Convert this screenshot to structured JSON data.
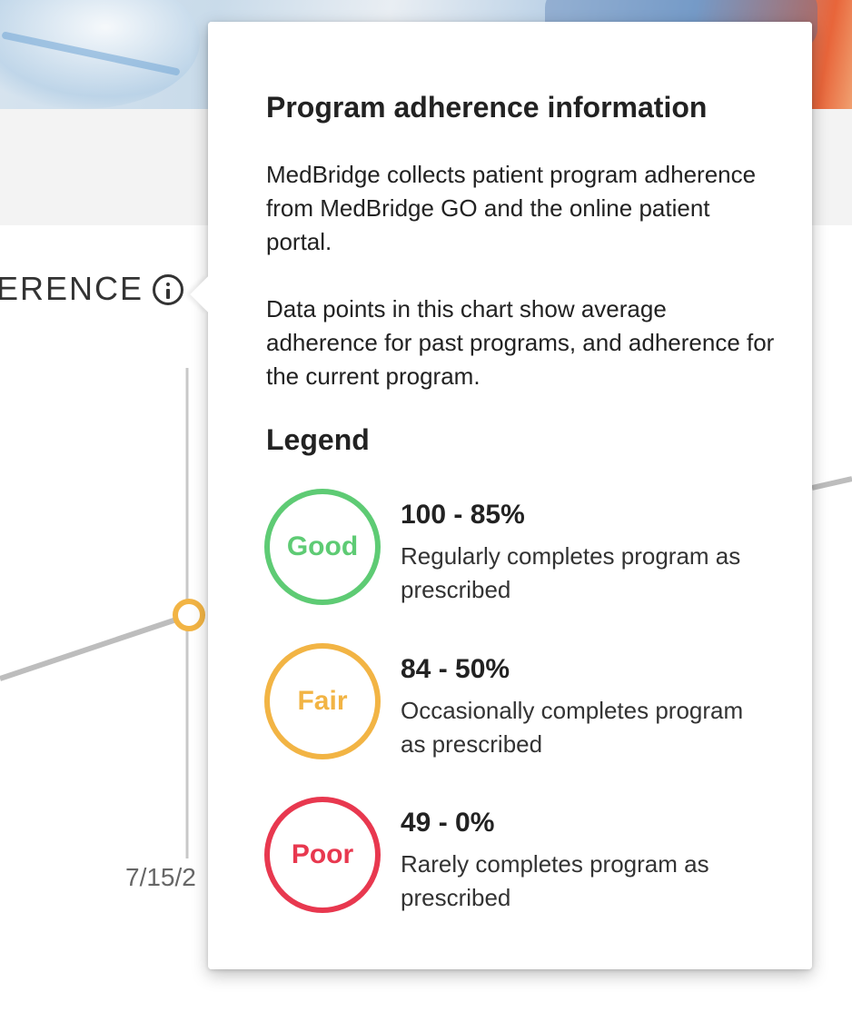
{
  "section": {
    "title": "ERENCE"
  },
  "chart": {
    "date_label": "7/15/2"
  },
  "popover": {
    "title": "Program adherence information",
    "paragraph1": "MedBridge collects patient program adherence from MedBridge GO and the online patient portal.",
    "paragraph2": "Data points in this chart show average adherence for past programs, and adherence for the current program.",
    "legend_title": "Legend",
    "legend": [
      {
        "badge": "Good",
        "range": "100 - 85%",
        "description": "Regularly completes program as prescribed",
        "color": "#5ecb74"
      },
      {
        "badge": "Fair",
        "range": "84 - 50%",
        "description": "Occasionally completes program as prescribed",
        "color": "#f2b444"
      },
      {
        "badge": "Poor",
        "range": "49 - 0%",
        "description": "Rarely completes program as prescribed",
        "color": "#e8384f"
      }
    ]
  },
  "colors": {
    "accent_fair": "#f2b444",
    "line": "#bdbdbd"
  }
}
